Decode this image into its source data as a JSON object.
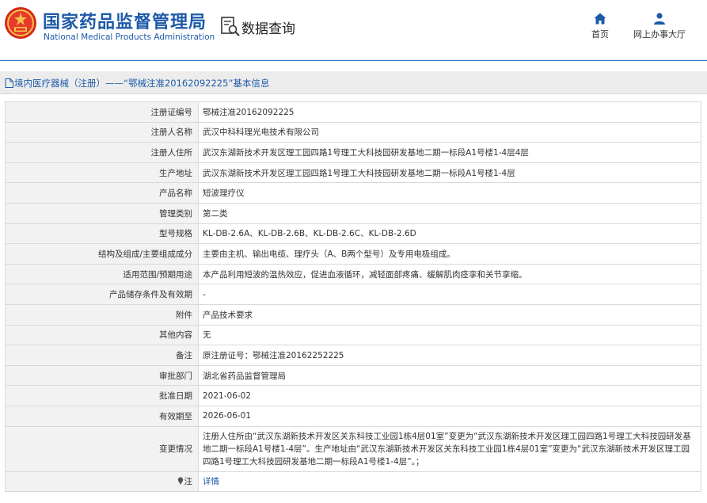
{
  "header": {
    "site_name_cn": "国家药品监督管理局",
    "site_name_en": "National Medical Products Administration",
    "data_query_label": "数据查询",
    "nav": [
      {
        "label": "首页",
        "icon": "home-icon"
      },
      {
        "label": "网上办事大厅",
        "icon": "user-icon"
      }
    ]
  },
  "breadcrumb": {
    "text": "境内医疗器械（注册）——“鄂械注准20162092225”基本信息"
  },
  "record": {
    "rows": [
      {
        "key": "注册证编号",
        "value": "鄂械注准20162092225"
      },
      {
        "key": "注册人名称",
        "value": "武汉中科科理光电技术有限公司"
      },
      {
        "key": "注册人住所",
        "value": "武汉东湖新技术开发区理工园四路1号理工大科技园研发基地二期一标段A1号楼1-4层4层"
      },
      {
        "key": "生产地址",
        "value": "武汉东湖新技术开发区理工园四路1号理工大科技园研发基地二期一标段A1号楼1-4层"
      },
      {
        "key": "产品名称",
        "value": "短波理疗仪"
      },
      {
        "key": "管理类别",
        "value": "第二类"
      },
      {
        "key": "型号规格",
        "value": "KL-DB-2.6A、KL-DB-2.6B、KL-DB-2.6C、KL-DB-2.6D"
      },
      {
        "key": "结构及组成/主要组成成分",
        "value": "主要由主机、输出电缆、理疗头（A、B两个型号）及专用电极组成。"
      },
      {
        "key": "适用范围/预期用途",
        "value": "本产品利用短波的温热效应，促进血液循环，减轻面部疼痛、缓解肌肉痉挛和关节挛缩。"
      },
      {
        "key": "产品储存条件及有效期",
        "value": "-"
      },
      {
        "key": "附件",
        "value": "产品技术要求"
      },
      {
        "key": "其他内容",
        "value": "无"
      },
      {
        "key": "备注",
        "value": "原注册证号：鄂械注准20162252225"
      },
      {
        "key": "审批部门",
        "value": "湖北省药品监督管理局"
      },
      {
        "key": "批准日期",
        "value": "2021-06-02"
      },
      {
        "key": "有效期至",
        "value": "2026-06-01"
      },
      {
        "key": "变更情况",
        "value": "注册人住所由“武汉东湖新技术开发区关东科技工业园1栋4层01室”变更为“武汉东湖新技术开发区理工园四路1号理工大科技园研发基地二期一标段A1号楼1-4层”。生产地址由“武汉东湖新技术开发区关东科技工业园1栋4层01室”变更为“武汉东湖新技术开发区理工园四路1号理工大科技园研发基地二期一标段A1号楼1-4层”。；"
      }
    ],
    "note_key": "注",
    "note_link": "详情"
  },
  "colors": {
    "brand_blue": "#1d5aa8",
    "key_bg": "#f2f2f2",
    "border": "#d9d9d9"
  }
}
